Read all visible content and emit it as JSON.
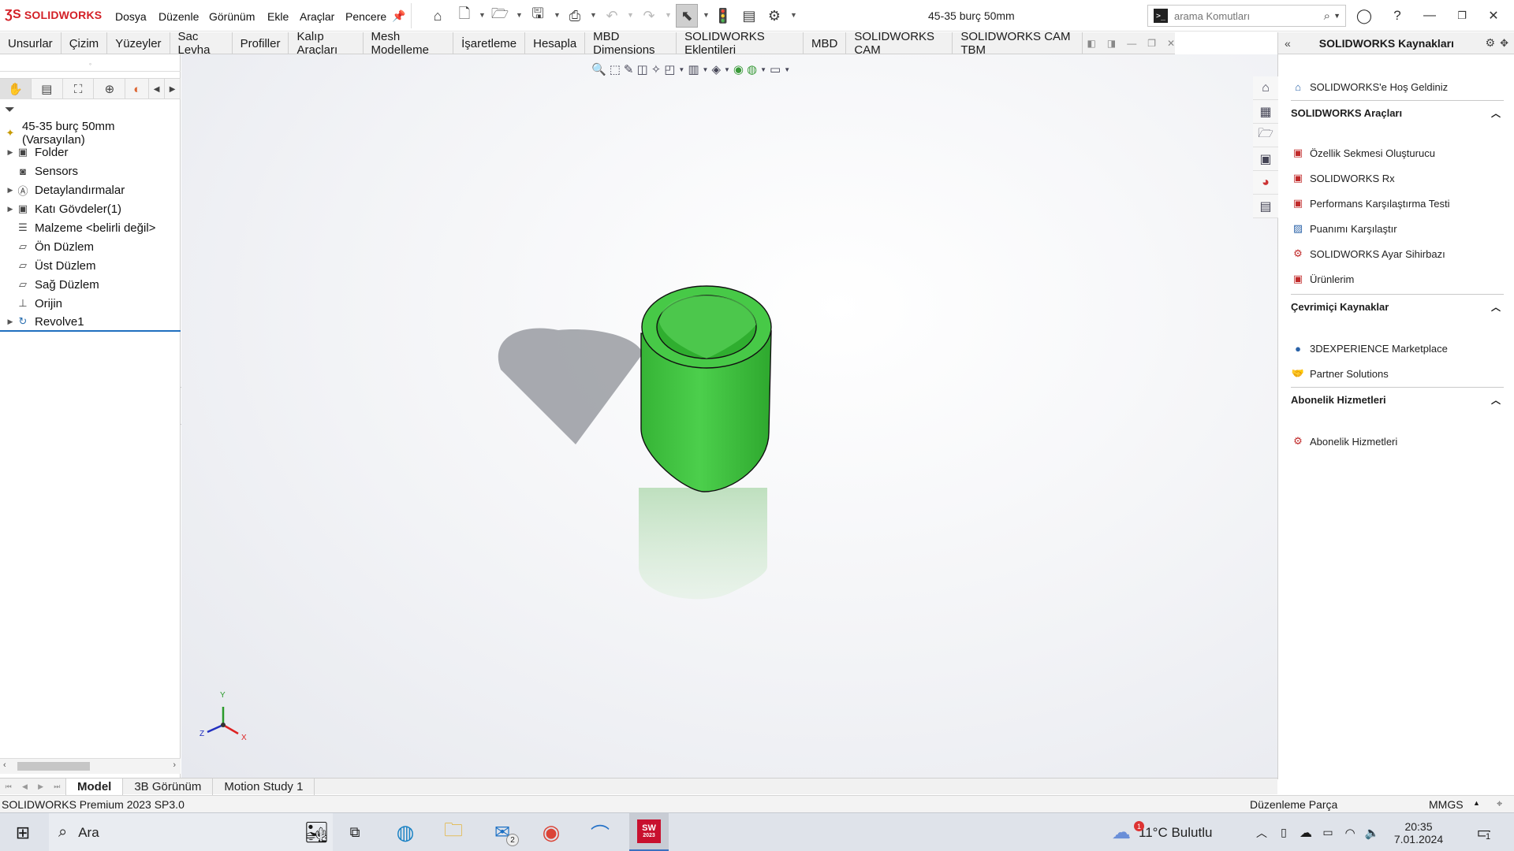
{
  "app": {
    "logo_text": "SOLIDWORKS",
    "document_title": "45-35 burç 50mm",
    "menu": [
      "Dosya",
      "Düzenle",
      "Görünüm",
      "Ekle",
      "Araçlar",
      "Pencere"
    ],
    "search_placeholder": "arama Komutları"
  },
  "command_tabs": [
    "Unsurlar",
    "Çizim",
    "Yüzeyler",
    "Sac Levha",
    "Profiller",
    "Kalıp Araçları",
    "Mesh Modelleme",
    "İşaretleme",
    "Hesapla",
    "MBD Dimensions",
    "SOLIDWORKS Eklentileri",
    "MBD",
    "SOLIDWORKS CAM",
    "SOLIDWORKS CAM TBM"
  ],
  "feature_tree": {
    "root": "45-35 burç 50mm (Varsayılan)",
    "items": [
      {
        "label": "Folder",
        "expandable": true,
        "icon": "folder-icon"
      },
      {
        "label": "Sensors",
        "expandable": false,
        "icon": "sensor-icon"
      },
      {
        "label": "Detaylandırmalar",
        "expandable": true,
        "icon": "annotation-icon"
      },
      {
        "label": "Katı Gövdeler(1)",
        "expandable": true,
        "icon": "solid-bodies-icon"
      },
      {
        "label": "Malzeme <belirli değil>",
        "expandable": false,
        "icon": "material-icon"
      },
      {
        "label": "Ön Düzlem",
        "expandable": false,
        "icon": "plane-icon"
      },
      {
        "label": "Üst Düzlem",
        "expandable": false,
        "icon": "plane-icon"
      },
      {
        "label": "Sağ Düzlem",
        "expandable": false,
        "icon": "plane-icon"
      },
      {
        "label": "Orijin",
        "expandable": false,
        "icon": "origin-icon"
      },
      {
        "label": "Revolve1",
        "expandable": true,
        "icon": "revolve-icon"
      }
    ]
  },
  "task_pane": {
    "title": "SOLIDWORKS Kaynakları",
    "welcome": "SOLIDWORKS'e Hoş Geldiniz",
    "sections": [
      {
        "title": "SOLIDWORKS Araçları",
        "items": [
          "Özellik Sekmesi Oluşturucu",
          "SOLIDWORKS Rx",
          "Performans Karşılaştırma Testi",
          "Puanımı Karşılaştır",
          "SOLIDWORKS Ayar Sihirbazı",
          "Ürünlerim"
        ]
      },
      {
        "title": "Çevrimiçi Kaynaklar",
        "items": [
          "3DEXPERIENCE Marketplace",
          "Partner Solutions"
        ]
      },
      {
        "title": "Abonelik Hizmetleri",
        "items": [
          "Abonelik Hizmetleri"
        ]
      }
    ]
  },
  "bottom_tabs": [
    "Model",
    "3B Görünüm",
    "Motion Study 1"
  ],
  "status": {
    "left": "SOLIDWORKS Premium 2023 SP3.0",
    "mode": "Düzenleme Parça",
    "units": "MMGS"
  },
  "taskbar": {
    "search_label": "Ara",
    "weather": "11°C Bulutlu",
    "time": "20:35",
    "date": "7.01.2024",
    "mail_badge": "2",
    "weather_badge": "1",
    "notif_badge": "1",
    "sw_badge": "2023"
  },
  "triad": {
    "x": "X",
    "y": "Y",
    "z": "Z"
  },
  "colors": {
    "model_green": "#3cc23c",
    "brand_red": "#d32027",
    "active_blue": "#1f6fbf"
  }
}
